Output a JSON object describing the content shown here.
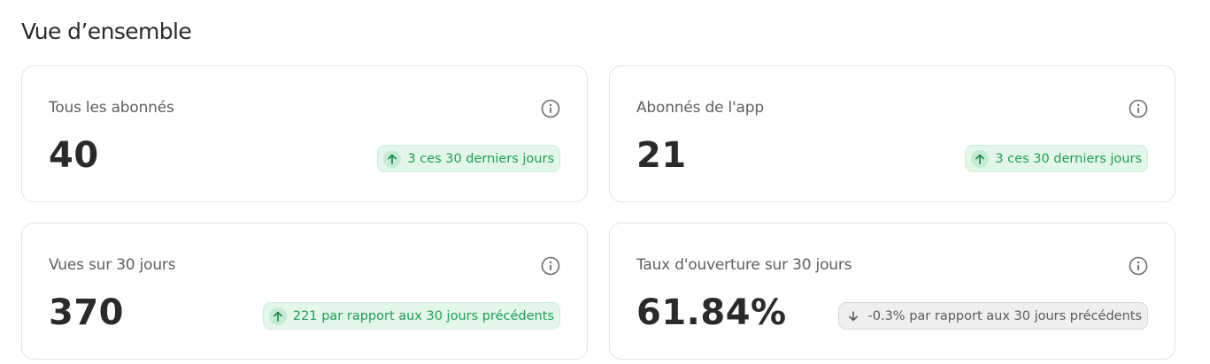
{
  "section": {
    "title": "Vue d’ensemble"
  },
  "cards": [
    {
      "label": "Tous les abonnés",
      "value": "40",
      "trend": "up",
      "badge": "3 ces 30 derniers jours"
    },
    {
      "label": "Abonnés de l'app",
      "value": "21",
      "trend": "up",
      "badge": "3 ces 30 derniers jours"
    },
    {
      "label": "Vues sur 30 jours",
      "value": "370",
      "trend": "up",
      "badge": "221 par rapport aux 30 jours précédents"
    },
    {
      "label": "Taux d'ouverture sur 30 jours",
      "value": "61.84%",
      "trend": "down",
      "badge": "-0.3% par rapport aux 30 jours précédents"
    }
  ],
  "icons": {
    "info": "info-icon",
    "up": "arrow-up-icon",
    "down": "arrow-down-icon"
  },
  "colors": {
    "positive": "#1f9d55",
    "positive_bg": "#e3f6ea",
    "neutral": "#5b5b5b",
    "neutral_bg": "#efefef",
    "border": "#e2e2e2"
  }
}
